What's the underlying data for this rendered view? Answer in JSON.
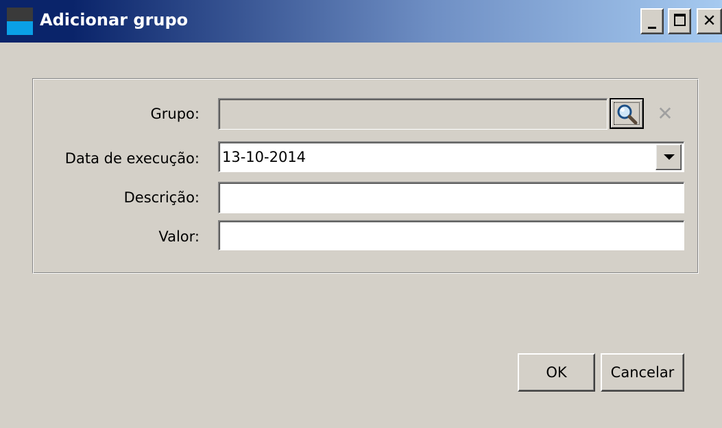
{
  "window": {
    "title": "Adicionar grupo",
    "title_icon": "app-icon",
    "controls": {
      "minimize_icon": "minimize-icon",
      "maximize_icon": "maximize-icon",
      "close_icon": "close-icon",
      "close_glyph": "✕"
    }
  },
  "form": {
    "grupo": {
      "label": "Grupo:",
      "value": ""
    },
    "search_icon": "magnifier-icon",
    "clear_glyph": "✕",
    "data_execucao": {
      "label": "Data de execução:",
      "value": "13-10-2014"
    },
    "descricao": {
      "label": "Descrição:",
      "value": ""
    },
    "valor": {
      "label": "Valor:",
      "value": ""
    }
  },
  "actions": {
    "ok_label": "OK",
    "cancel_label": "Cancelar"
  },
  "colors": {
    "titlebar_start": "#0a246a",
    "titlebar_end": "#a6caf0",
    "window_bg": "#d4d0c8"
  }
}
